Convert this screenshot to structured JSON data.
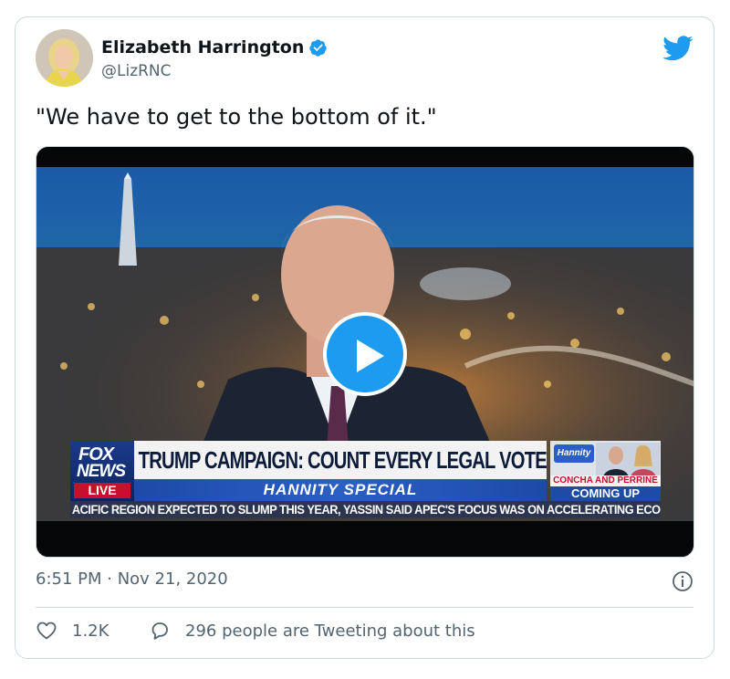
{
  "author": {
    "display_name": "Elizabeth Harrington",
    "handle": "@LizRNC",
    "verified": true,
    "avatar_icon": "avatar-photo"
  },
  "tweet": {
    "text": "\"We have to get to the bottom of it.\"",
    "timestamp": "6:51 PM · Nov 21, 2020"
  },
  "media": {
    "type": "video",
    "play_icon": "play-icon",
    "broadcast": {
      "network_top": "FOX",
      "network_bottom": "NEWS",
      "live": "LIVE",
      "headline": "TRUMP CAMPAIGN: COUNT EVERY LEGAL VOTE",
      "subheadline": "HANNITY SPECIAL",
      "promo_logo": "Hannity",
      "promo_red": "CONCHA AND PERRINE",
      "promo_blue": "COMING UP",
      "ticker": "ACIFIC REGION EXPECTED TO SLUMP THIS YEAR, YASSIN SAID APEC'S FOCUS WAS ON ACCELERATING ECO"
    }
  },
  "actions": {
    "like_count": "1.2K",
    "reply_text": "296 people are Tweeting about this"
  },
  "colors": {
    "twitter_blue": "#1d9bf0",
    "secondary_text": "#536471",
    "border": "#cfd9de",
    "fox_red": "#c8102e",
    "fox_blue": "#1e4aa8"
  }
}
